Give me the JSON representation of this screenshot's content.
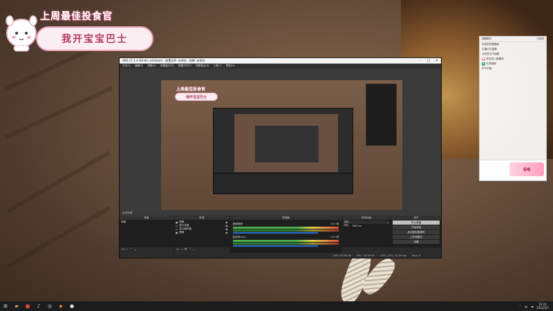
{
  "overlay": {
    "title": "上周最佳投食官",
    "subtitle": "我开宝宝巴士"
  },
  "obs": {
    "window_title": "OBS 27.2.4 (64-bit, windows) - 配置文件: 未命名 - 场景: 未命名",
    "menu": [
      "文件(F)",
      "编辑(E)",
      "视图(V)",
      "停靠窗口(D)",
      "配置文件(P)",
      "场景集合(S)",
      "工具(T)",
      "帮助(H)"
    ],
    "docks_label": "无选择源",
    "scenes": {
      "title": "场景",
      "items": [
        "场景"
      ]
    },
    "sources": {
      "title": "来源",
      "items": [
        "图像",
        "窗口采集",
        "显示器采集",
        "图像"
      ]
    },
    "mixer": {
      "title": "混音器",
      "channels": [
        {
          "name": "桌面音频",
          "db": "0.0 dB"
        },
        {
          "name": "麦克风/Aux",
          "db": "0.0 dB"
        }
      ]
    },
    "transitions": {
      "title": "转场动画",
      "type": "淡化",
      "duration_label": "时长",
      "duration": "300 ms"
    },
    "controls": {
      "title": "控件",
      "buttons": [
        "停止直播",
        "开始录制",
        "启动虚拟摄像机",
        "工作室模式",
        "设置",
        "退出"
      ]
    },
    "status": [
      "LIVE: 00:00:00",
      "REC: 00:00:00",
      "CPU: 2.9%, 30.00 fps",
      "kb/s: 0"
    ]
  },
  "chat": {
    "header_left": "弹幕聊天",
    "header_right": "已关闭",
    "messages": [
      "欢迎来到直播间",
      "主播正在直播",
      "点赞关注不迷路",
      "欢迎进入直播间",
      "礼物感谢",
      "天气不错"
    ],
    "gift_text": "投喂"
  },
  "taskbar": {
    "time": "16:22",
    "date": "2022/4/7"
  },
  "colors": {
    "accent_pink": "#b23a5a",
    "obs_bg": "#2b2b2b",
    "meter_green": "#4caf50"
  }
}
